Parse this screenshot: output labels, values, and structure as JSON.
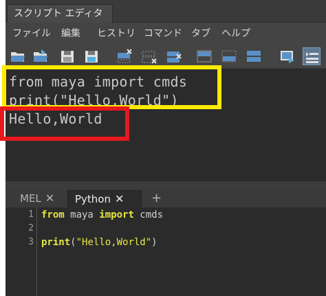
{
  "window": {
    "title": "スクリプト エディタ"
  },
  "menu": {
    "items": [
      "ファイル",
      "編集",
      "ヒストリ",
      "コマンド",
      "タブ",
      "ヘルプ"
    ]
  },
  "toolbar": {
    "icons": [
      "open-script-icon",
      "source-script-icon",
      "save-script-icon",
      "save-script-to-shelf-icon",
      "clear-history-icon",
      "clear-input-icon",
      "clear-all-icon",
      "show-history-only-icon",
      "show-input-only-icon",
      "show-both-icon",
      "execute-all-icon",
      "execute-icon"
    ]
  },
  "output": {
    "lines": [
      "from maya import cmds",
      "print(\"Hello,World\")",
      "Hello,World"
    ]
  },
  "annotations": {
    "yellow_color": "#ffea00",
    "red_color": "#e8191c"
  },
  "tabs": [
    {
      "label": "MEL",
      "close": "✕",
      "active": false
    },
    {
      "label": "Python",
      "close": "✕",
      "active": true
    },
    {
      "label": "+",
      "close": "",
      "active": false
    }
  ],
  "editor": {
    "line_numbers": [
      "1",
      "2",
      "3"
    ],
    "lines": [
      {
        "kw1": "from",
        "mid": " maya ",
        "kw2": "import",
        "rest": " cmds"
      },
      {
        "text": ""
      },
      {
        "kw": "print",
        "open": "(",
        "str": "\"Hello,World\"",
        "close": ")"
      }
    ]
  },
  "colors": {
    "keyword": "#e7e742",
    "background": "#2b2b2b"
  }
}
